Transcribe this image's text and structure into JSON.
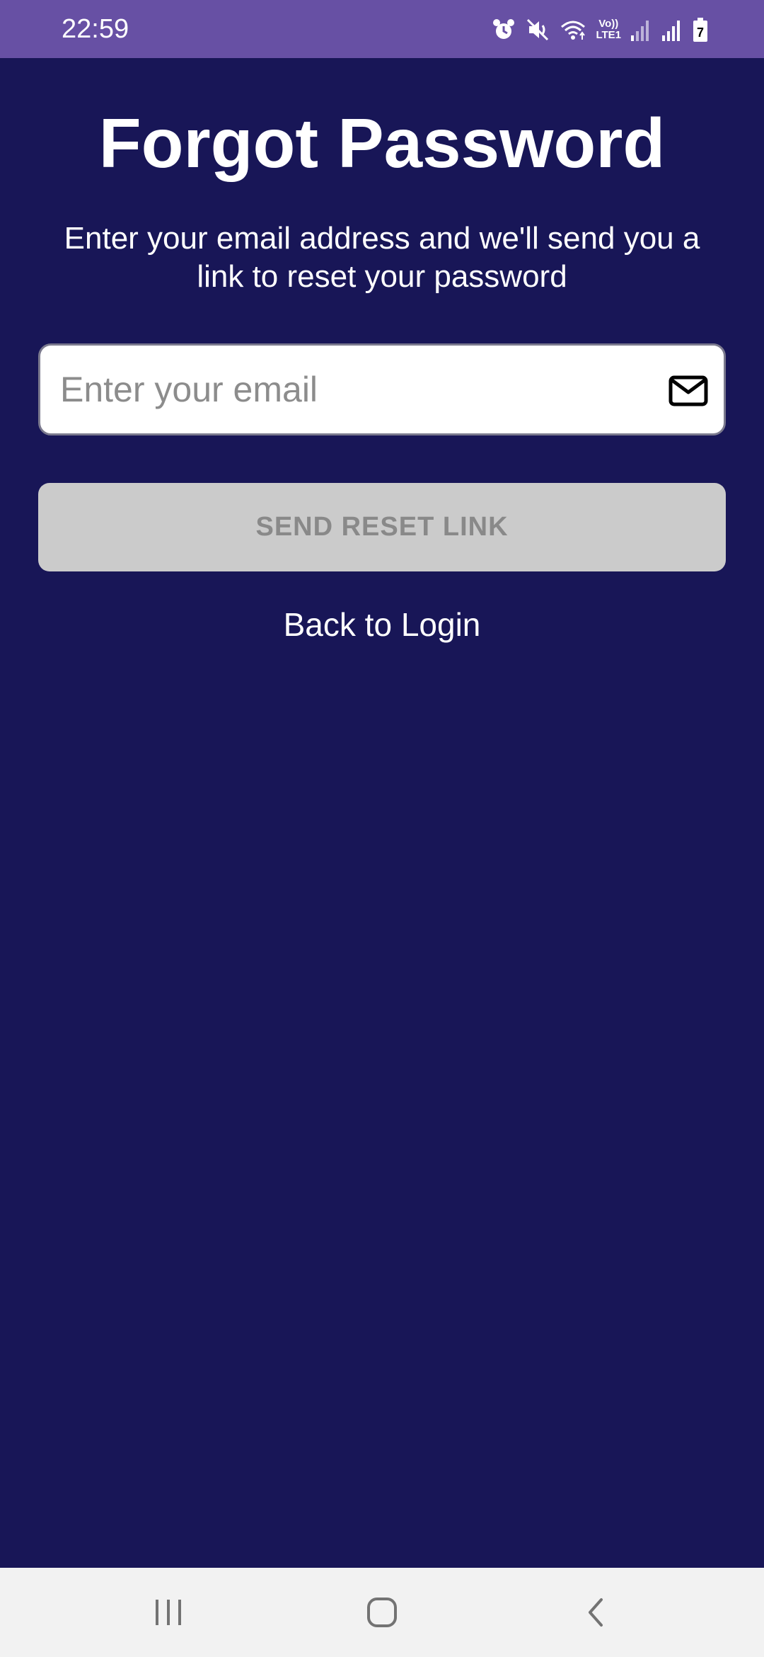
{
  "status_bar": {
    "time": "22:59",
    "icons": [
      "alarm-icon",
      "mute-icon",
      "wifi-icon",
      "volte-icon",
      "signal-icon",
      "signal-icon",
      "battery-charging-icon"
    ],
    "volte_top": "Vo))",
    "volte_bottom": "LTE1",
    "battery_level": "7"
  },
  "page": {
    "title": "Forgot Password",
    "subtitle": "Enter your email address and we'll send you a link to reset your password"
  },
  "email": {
    "placeholder": "Enter your email",
    "value": "",
    "icon": "mail-icon"
  },
  "send_button": {
    "label": "SEND RESET LINK"
  },
  "back_link": {
    "label": "Back to Login"
  },
  "nav_bar": {
    "items": [
      "recents-icon",
      "home-icon",
      "back-icon"
    ]
  },
  "colors": {
    "status_bar_bg": "#6750a4",
    "page_bg": "#181657",
    "button_disabled_bg": "#cbcbcb",
    "button_disabled_text": "#898989",
    "nav_bar_bg": "#f2f2f2"
  }
}
